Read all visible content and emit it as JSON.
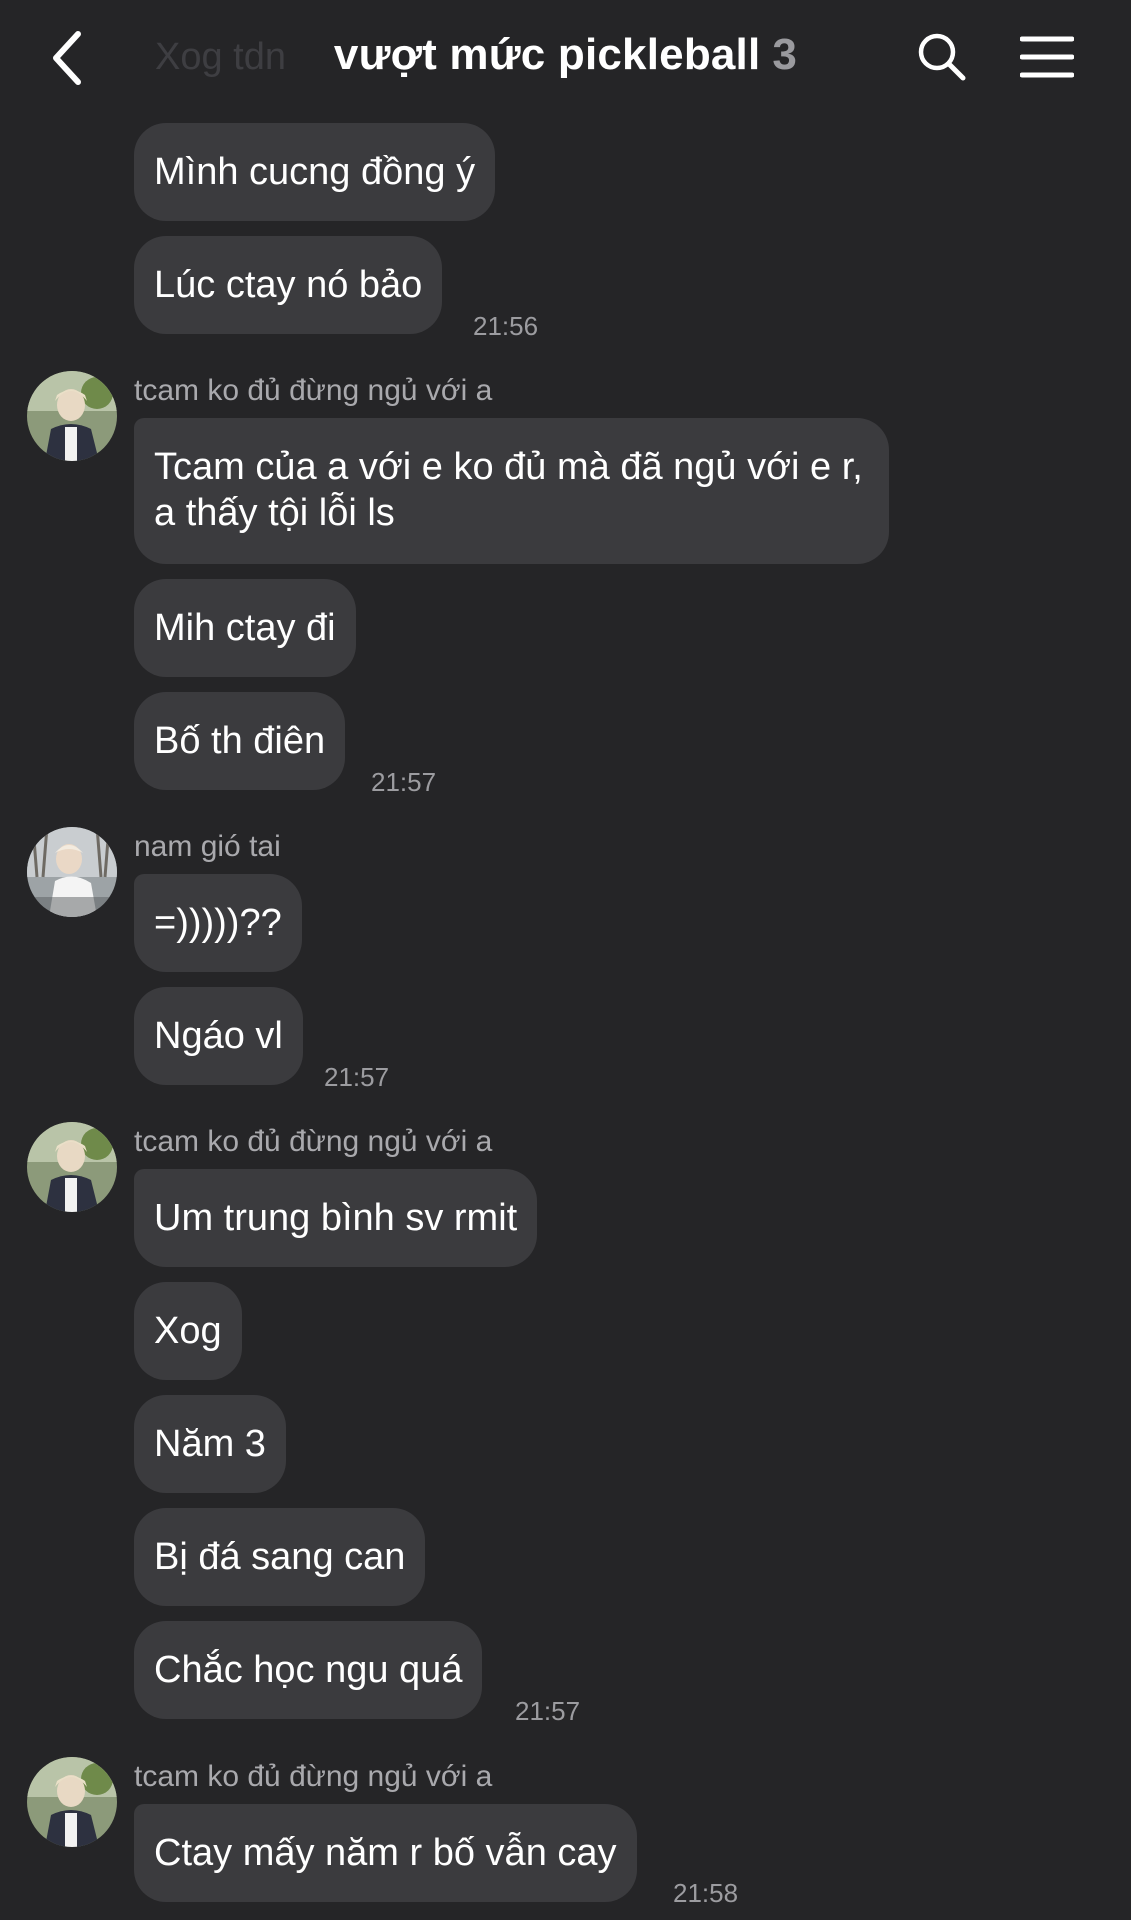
{
  "header": {
    "preview_text": "Xog tdn",
    "title": "vượt mức pickleball",
    "member_count": "3"
  },
  "messages": [
    {
      "text": "Mình cucng đồng ý"
    },
    {
      "text": "Lúc ctay nó bảo",
      "time": "21:56"
    },
    {
      "sender": "tcam ko đủ đừng ngủ với a",
      "text": "Tcam của a với e ko đủ mà đã ngủ với e r, a thấy tội lỗi ls"
    },
    {
      "text": "Mih ctay đi"
    },
    {
      "text": "Bố th điên",
      "time": "21:57"
    },
    {
      "sender": "nam gió tai",
      "text": "=)))))??"
    },
    {
      "text": "Ngáo vl",
      "time": "21:57"
    },
    {
      "sender": "tcam ko đủ đừng ngủ với a",
      "text": "Um trung bình sv rmit"
    },
    {
      "text": "Xog"
    },
    {
      "text": "Năm 3"
    },
    {
      "text": "Bị đá sang can"
    },
    {
      "text": "Chắc học ngu quá",
      "time": "21:57"
    },
    {
      "sender": "tcam ko đủ đừng ngủ với a",
      "text": "Ctay mấy năm r bố vẫn cay",
      "time": "21:58"
    }
  ]
}
